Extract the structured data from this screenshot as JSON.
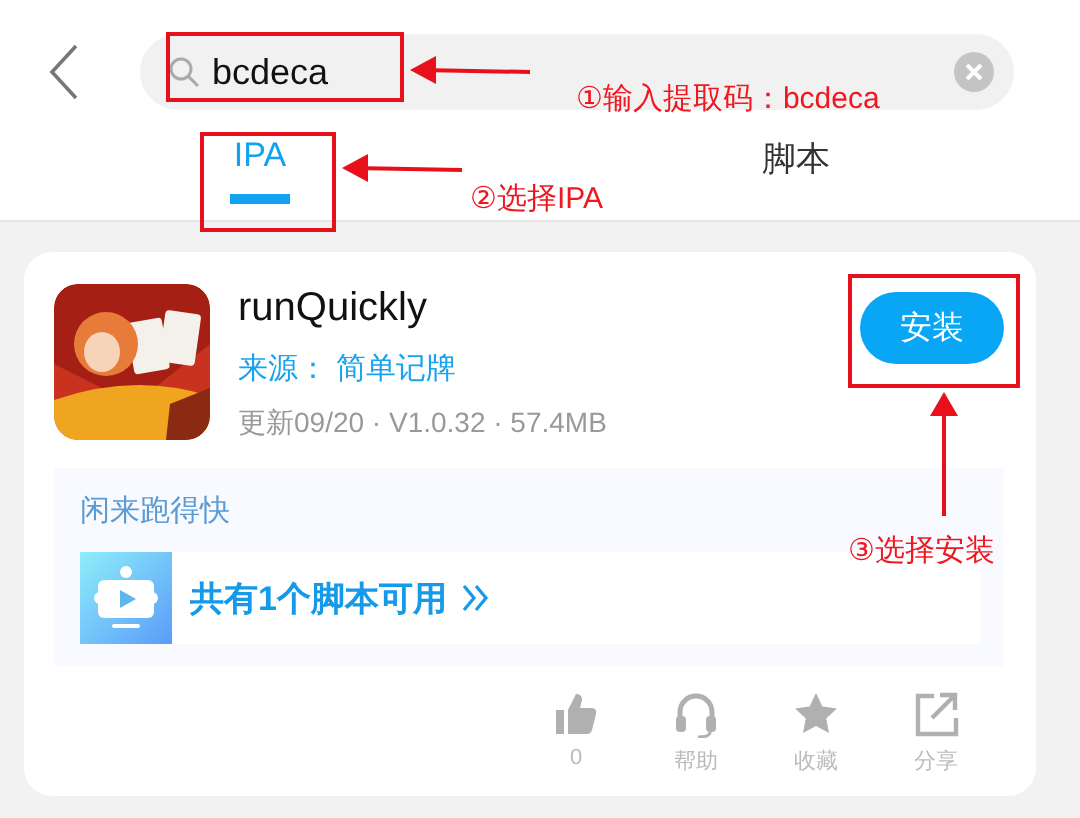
{
  "search": {
    "value": "bcdeca"
  },
  "tabs": [
    {
      "label": "IPA",
      "selected": true
    },
    {
      "label": "脚本",
      "selected": false
    }
  ],
  "app": {
    "name": "runQuickly",
    "source": "来源： 简单记牌",
    "meta": "更新09/20 · V1.0.32 · 57.4MB",
    "install_button": "安装",
    "script_group": "闲来跑得快",
    "script_link": "共有1个脚本可用"
  },
  "actions": [
    {
      "kind": "like",
      "label": "0"
    },
    {
      "kind": "help",
      "label": "帮助"
    },
    {
      "kind": "favorite",
      "label": "收藏"
    },
    {
      "kind": "share",
      "label": "分享"
    }
  ],
  "annotations": [
    {
      "text": "①输入提取码：bcdeca"
    },
    {
      "text": "②选择IPA"
    },
    {
      "text": "③选择安装"
    }
  ]
}
